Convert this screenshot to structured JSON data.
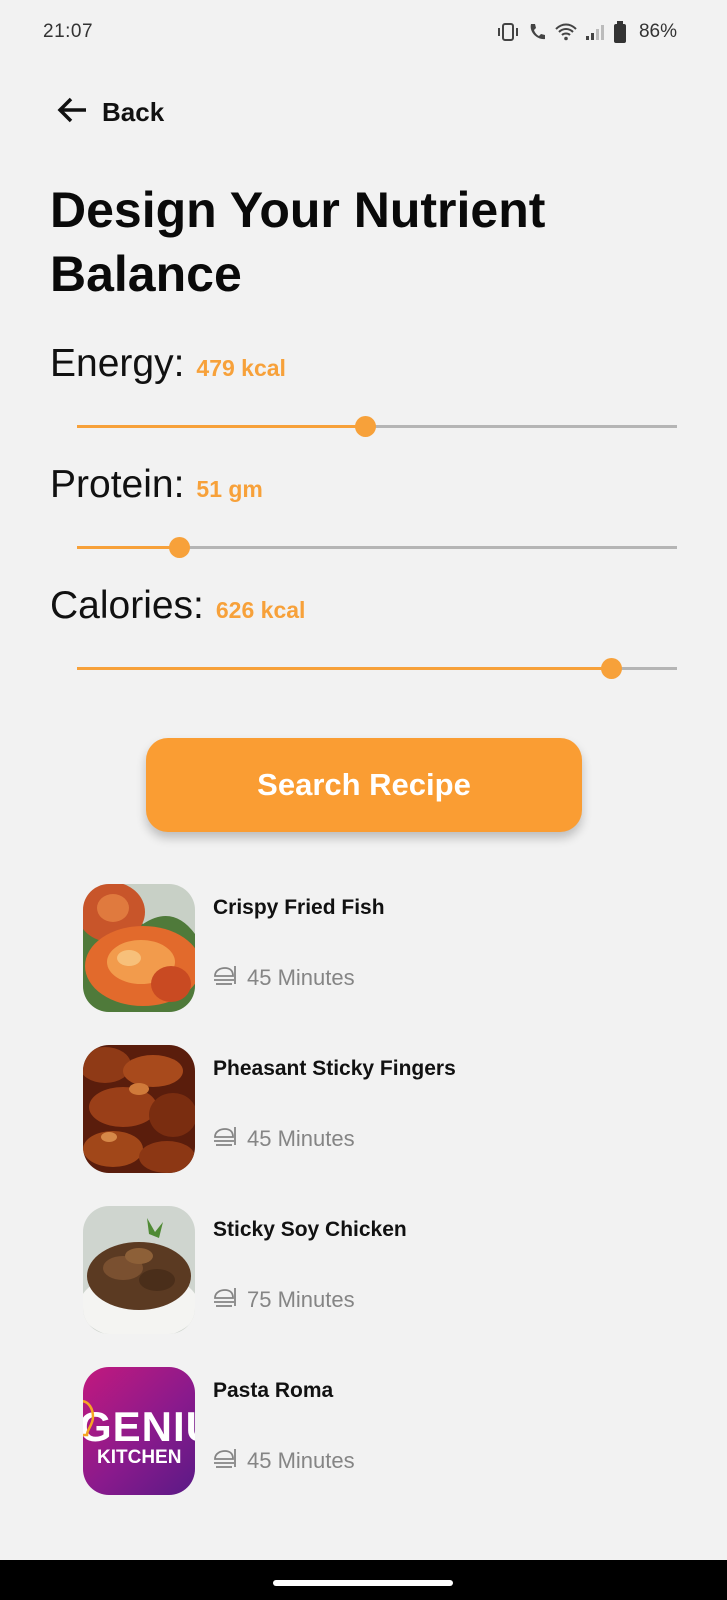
{
  "status_bar": {
    "time": "21:07",
    "battery": "86%"
  },
  "header": {
    "back_label": "Back",
    "title": "Design Your Nutrient Balance"
  },
  "nutrients": [
    {
      "label": "Energy:",
      "value": "479 kcal",
      "slider_fraction": 0.48
    },
    {
      "label": "Protein:",
      "value": "51 gm",
      "slider_fraction": 0.17
    },
    {
      "label": "Calories:",
      "value": "626 kcal",
      "slider_fraction": 0.89
    }
  ],
  "search_button": {
    "label": "Search Recipe"
  },
  "recipes": [
    {
      "name": "Crispy Fried Fish",
      "time": "45 Minutes"
    },
    {
      "name": "Pheasant Sticky Fingers",
      "time": "45 Minutes"
    },
    {
      "name": "Sticky Soy Chicken",
      "time": "75 Minutes"
    },
    {
      "name": "Pasta Roma",
      "time": "45 Minutes",
      "thumb_text": [
        "GENIU",
        "KITCHEN"
      ]
    }
  ],
  "colors": {
    "accent": "#fa9d33",
    "value_text": "#f7a13a",
    "background": "#f2f2f2",
    "track": "#b5b5b5"
  }
}
